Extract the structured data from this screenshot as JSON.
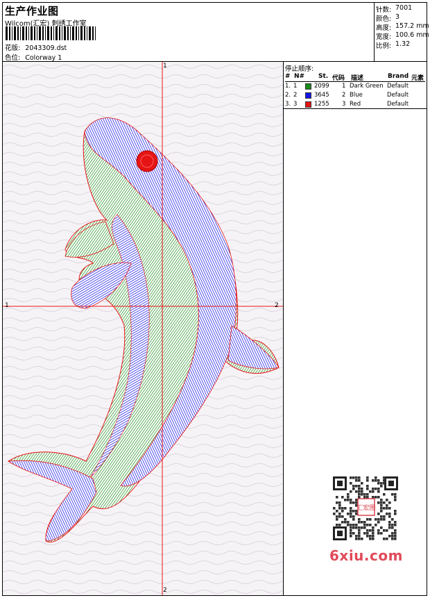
{
  "header": {
    "title": "生产作业图",
    "company": "Wilcom(汇宏) 刺绣工作室",
    "design_label": "花版:",
    "design_value": "2043309.dst",
    "colorway_label": "色位:",
    "colorway_value": "Colorway 1"
  },
  "specs": [
    {
      "label": "针数:",
      "value": "7001"
    },
    {
      "label": "颜色:",
      "value": "3"
    },
    {
      "label": "高度:",
      "value": "157.2 mm"
    },
    {
      "label": "宽度:",
      "value": "100.6 mm"
    },
    {
      "label": "比例:",
      "value": "1.32"
    }
  ],
  "axes": {
    "top": "1",
    "bottom": "2",
    "left": "1",
    "right": "2"
  },
  "stop_sequence": {
    "title": "停止顺序:",
    "columns": [
      "#",
      "N#",
      "St.",
      "代码",
      "描述",
      "Brand",
      "元素"
    ],
    "rows": [
      {
        "num": "1.",
        "n": "1",
        "color": "#1a8c1a",
        "stitches": "2099",
        "code": "1",
        "desc": "Dark Green",
        "brand": "Default"
      },
      {
        "num": "2.",
        "n": "2",
        "color": "#1414e6",
        "stitches": "3645",
        "code": "2",
        "desc": "Blue",
        "brand": "Default"
      },
      {
        "num": "3.",
        "n": "3",
        "color": "#e61414",
        "stitches": "1255",
        "code": "3",
        "desc": "Red",
        "brand": "Default"
      }
    ]
  },
  "qr": {
    "stamp_text": "汇宏图"
  },
  "watermark": "6xiu.com",
  "colors": {
    "green": "#1a8c1a",
    "blue": "#1414e6",
    "red": "#e61414",
    "axis": "#e61414"
  }
}
